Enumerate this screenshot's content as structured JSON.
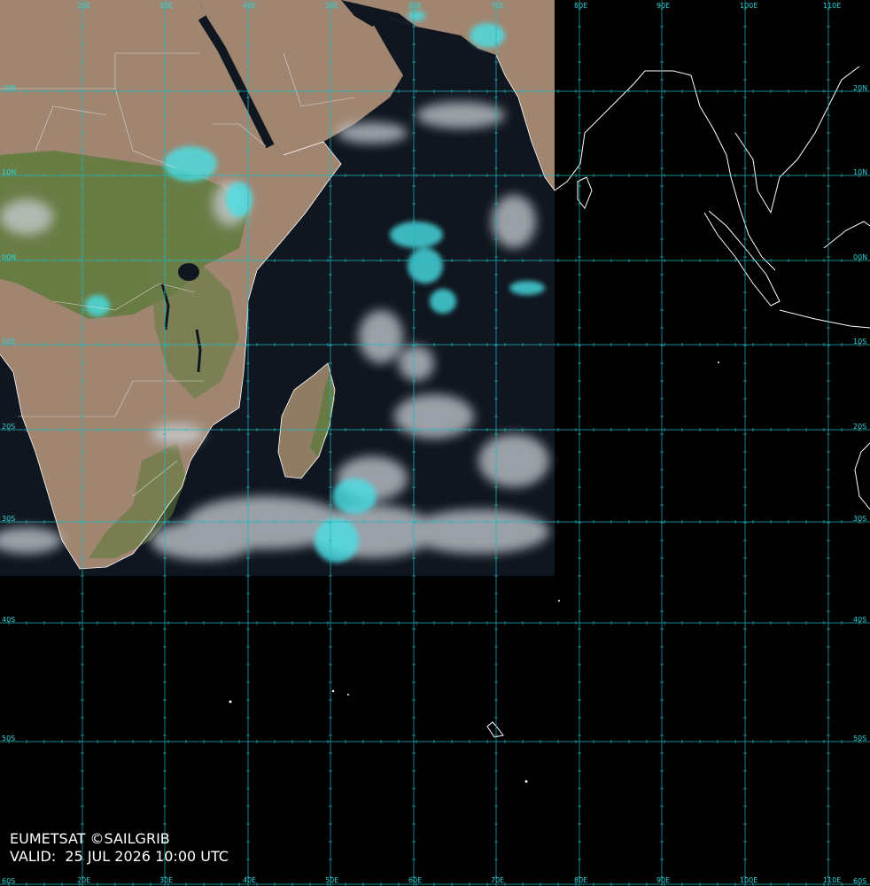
{
  "credit": {
    "line1": "EUMETSAT ©SAILGRIB",
    "line2": "VALID:  25 JUL 2026 10:00 UTC"
  },
  "colors": {
    "grid": "#1fb8bf",
    "coast": "#ffffff",
    "land": "#a08670",
    "vegetation": "#5f7a3c",
    "ocean": "#10161f",
    "cloud": "#c9cfd6",
    "ice_cloud": "#48e0e6"
  },
  "lon_labels": [
    "20E",
    "30E",
    "40E",
    "50E",
    "60E",
    "70E",
    "80E",
    "90E",
    "100E",
    "110E"
  ],
  "lat_labels": [
    "20N",
    "10N",
    "00N",
    "10S",
    "20S",
    "30S",
    "40S",
    "50S",
    "60S"
  ]
}
